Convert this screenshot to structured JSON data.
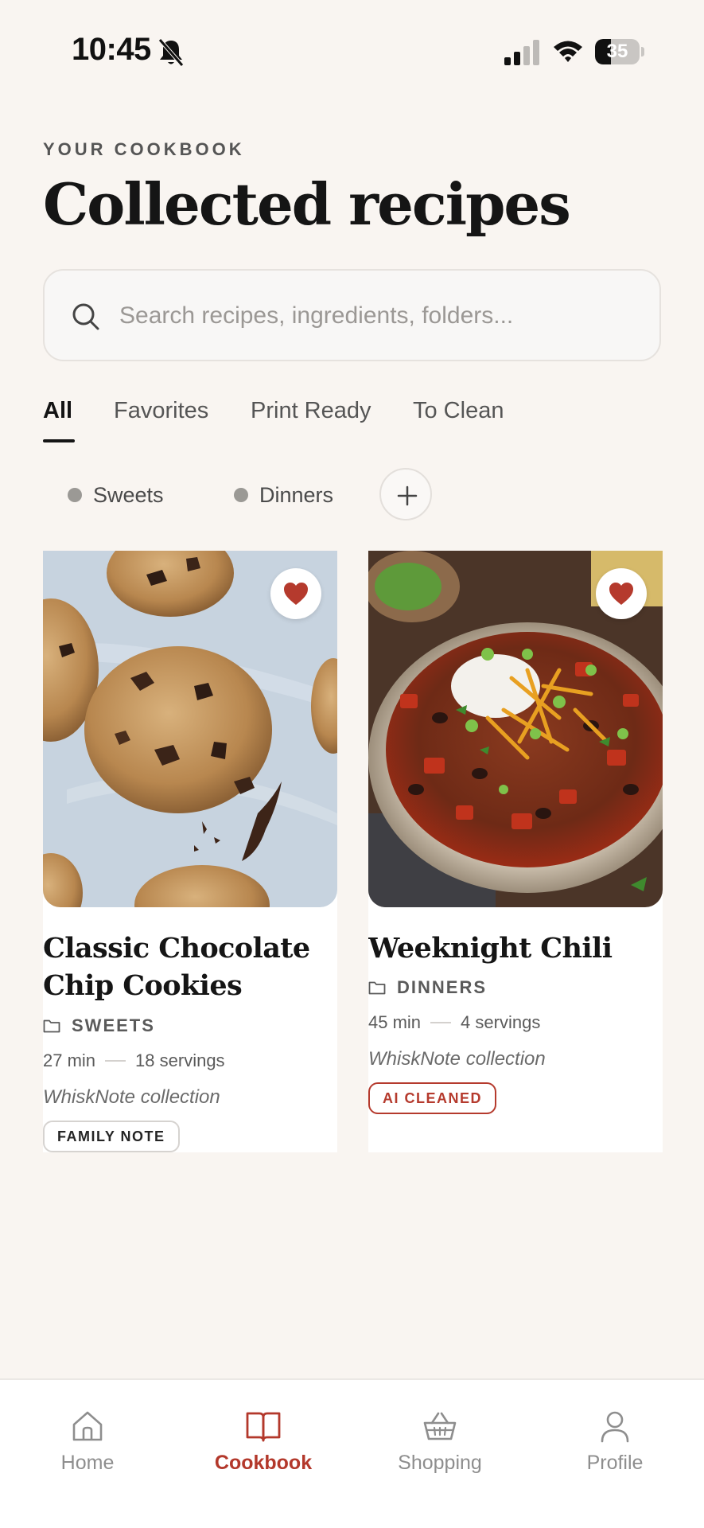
{
  "status_bar": {
    "time": "10:45",
    "battery_level": "35",
    "battery_fraction": 0.35,
    "icons": [
      "bell-off-icon",
      "cellular-signal-icon",
      "wifi-icon",
      "battery-icon"
    ]
  },
  "header": {
    "eyebrow": "YOUR COOKBOOK",
    "title": "Collected recipes"
  },
  "search": {
    "placeholder": "Search recipes, ingredients, folders...",
    "value": "",
    "icon": "search-icon"
  },
  "tabs": [
    {
      "label": "All",
      "active": true
    },
    {
      "label": "Favorites",
      "active": false
    },
    {
      "label": "Print Ready",
      "active": false
    },
    {
      "label": "To Clean",
      "active": false
    }
  ],
  "folders": [
    {
      "label": "Sweets"
    },
    {
      "label": "Dinners"
    }
  ],
  "add_folder_icon": "plus-icon",
  "recipes": [
    {
      "title": "Classic Chocolate Chip Cookies",
      "folder": "SWEETS",
      "time": "27 min",
      "servings": "18 servings",
      "collection": "WhiskNote collection",
      "badge": "FAMILY NOTE",
      "favorite": true
    },
    {
      "title": "Weeknight Chili",
      "folder": "DINNERS",
      "time": "45 min",
      "servings": "4 servings",
      "collection": "WhiskNote collection",
      "badge": "AI CLEANED",
      "favorite": true
    }
  ],
  "nav": [
    {
      "label": "Home",
      "icon": "home-icon",
      "active": false
    },
    {
      "label": "Cookbook",
      "icon": "book-icon",
      "active": true
    },
    {
      "label": "Shopping",
      "icon": "basket-icon",
      "active": false
    },
    {
      "label": "Profile",
      "icon": "user-icon",
      "active": false
    }
  ],
  "colors": {
    "background": "#f9f5f1",
    "accent": "#b3382b",
    "favorite": "#b53a2d",
    "text": "#151515"
  }
}
